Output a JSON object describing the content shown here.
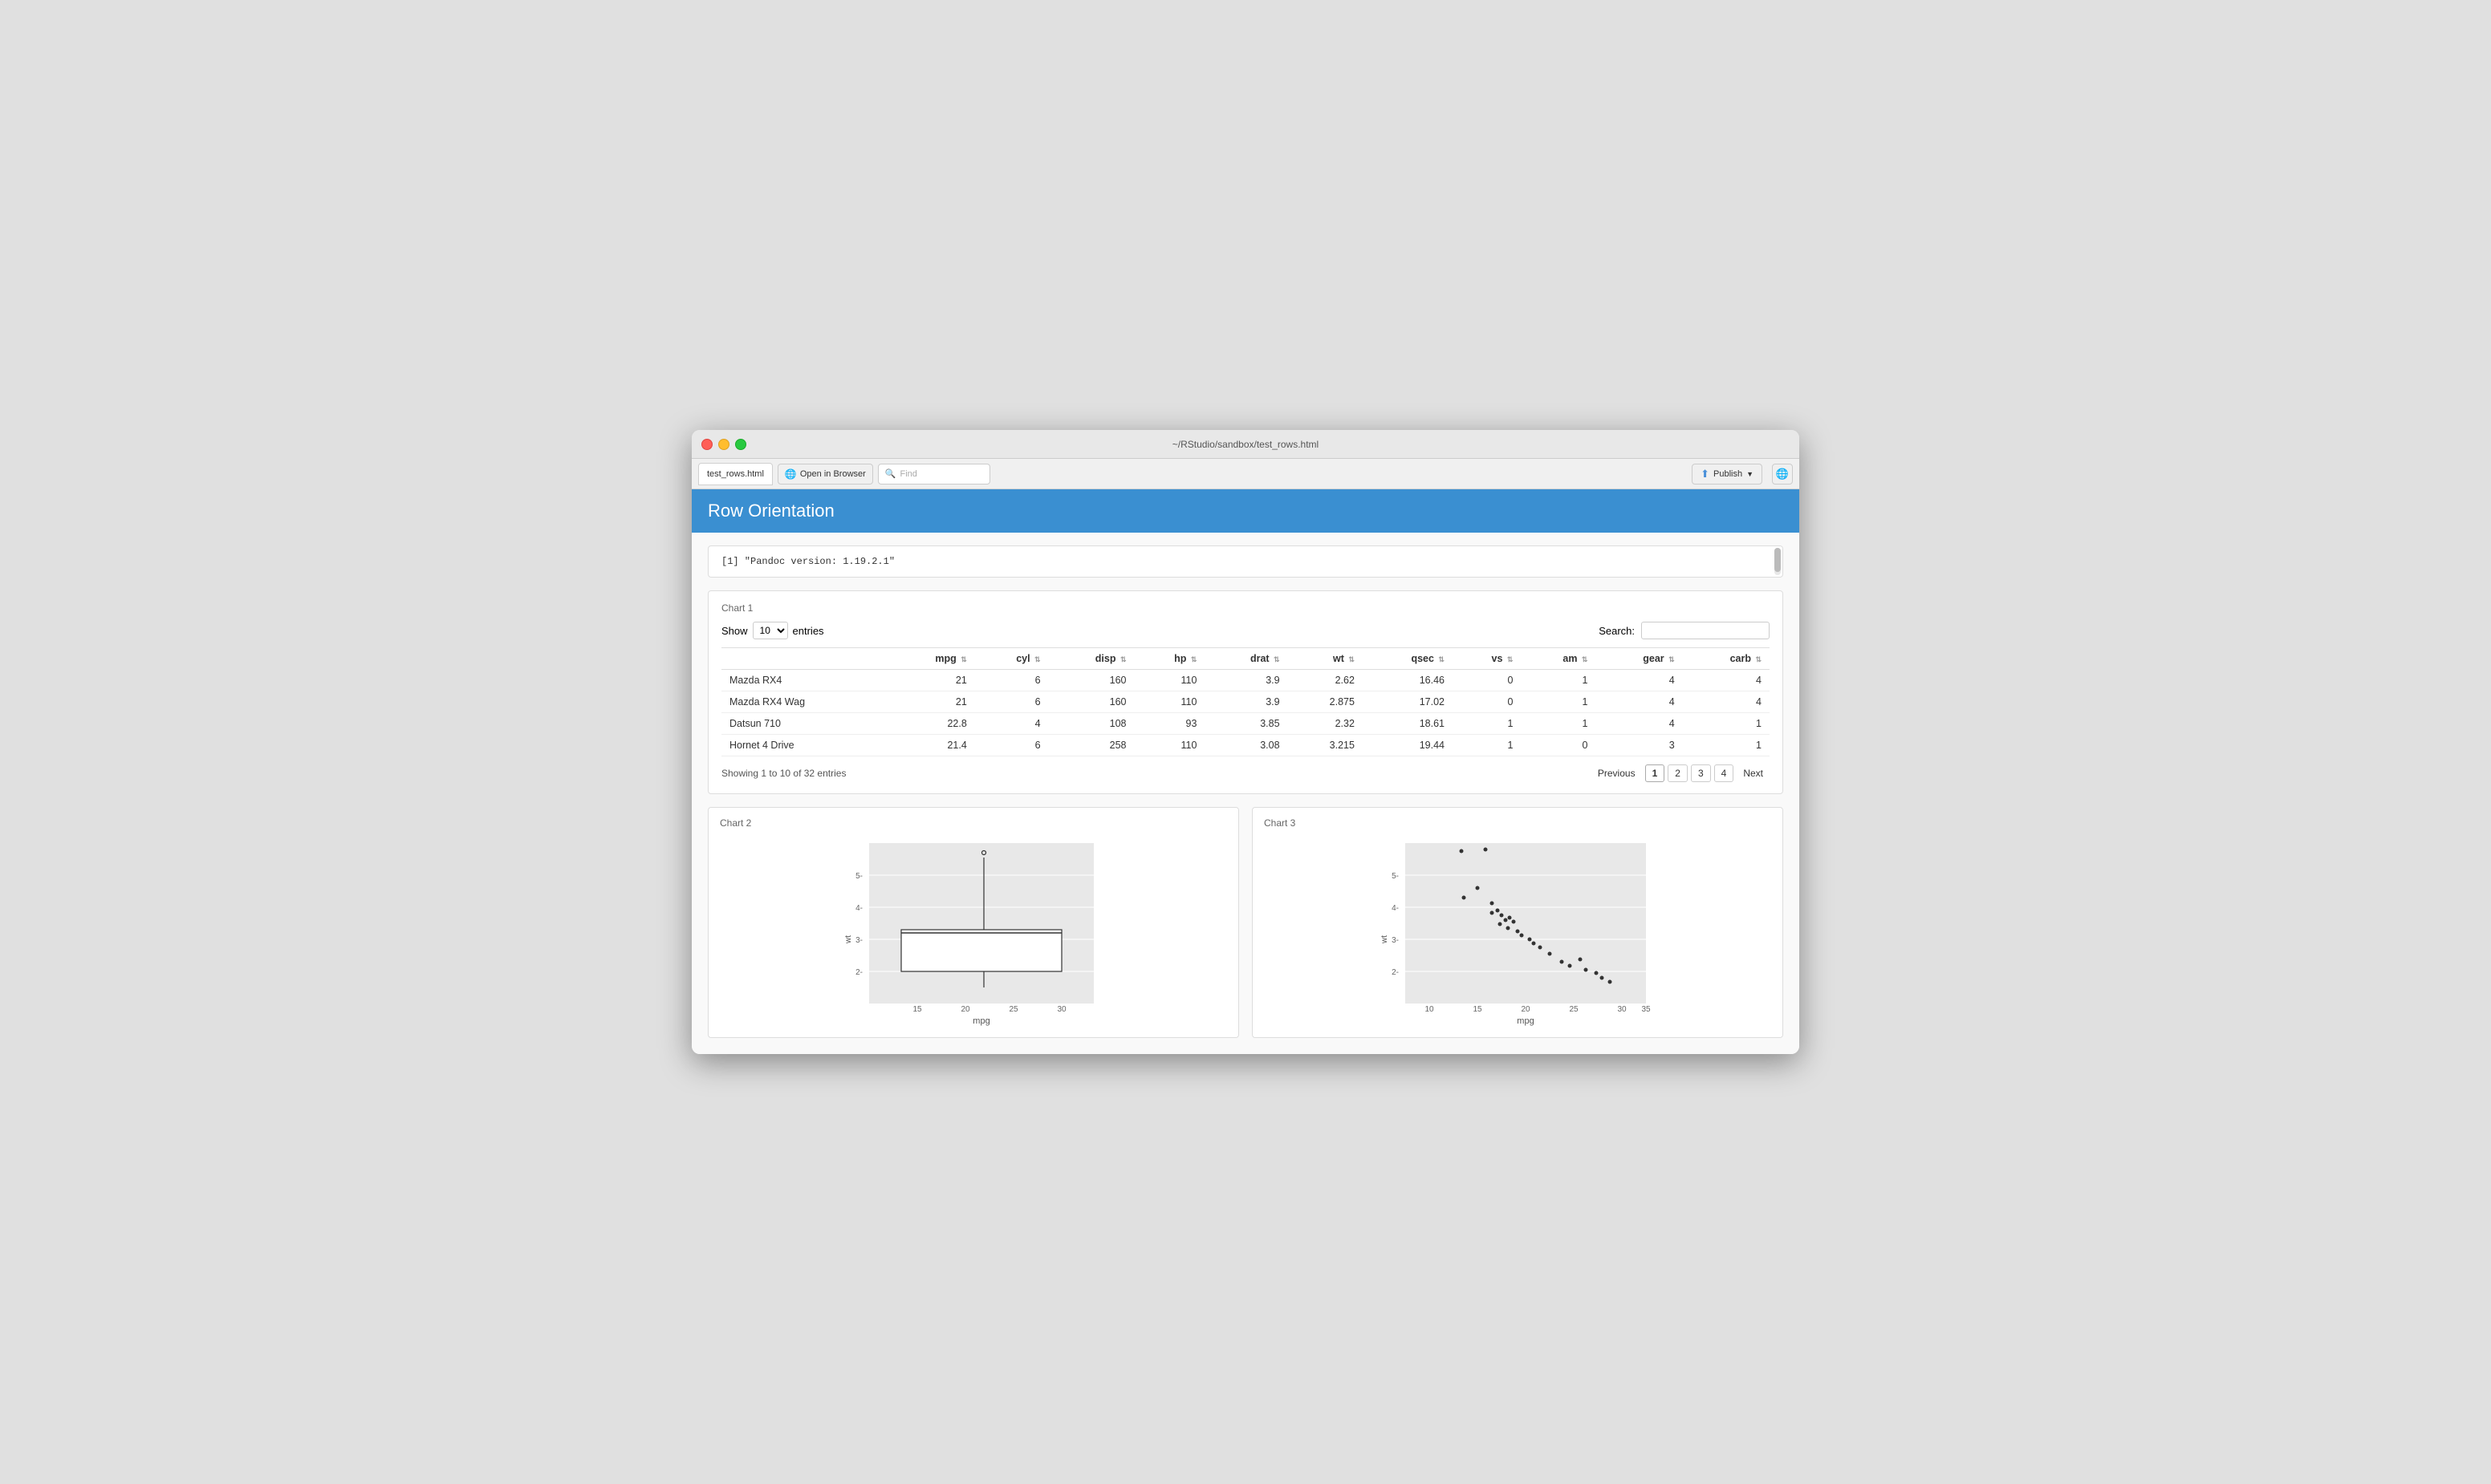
{
  "window": {
    "title": "~/RStudio/sandbox/test_rows.html"
  },
  "browser": {
    "tab_label": "test_rows.html",
    "open_in_browser": "Open in Browser",
    "find_placeholder": "Find",
    "publish_label": "Publish"
  },
  "page": {
    "header_title": "Row Orientation",
    "code_output": "[1] \"Pandoc version: 1.19.2.1\""
  },
  "chart1": {
    "label": "Chart 1",
    "show_label": "Show",
    "entries_value": "10",
    "entries_label": "entries",
    "search_label": "Search:",
    "columns": [
      "mpg",
      "cyl",
      "disp",
      "hp",
      "drat",
      "wt",
      "qsec",
      "vs",
      "am",
      "gear",
      "carb"
    ],
    "rows": [
      {
        "name": "Mazda RX4",
        "mpg": "21",
        "cyl": "6",
        "disp": "160",
        "hp": "110",
        "drat": "3.9",
        "wt": "2.62",
        "qsec": "16.46",
        "vs": "0",
        "am": "1",
        "gear": "4",
        "carb": "4"
      },
      {
        "name": "Mazda RX4 Wag",
        "mpg": "21",
        "cyl": "6",
        "disp": "160",
        "hp": "110",
        "drat": "3.9",
        "wt": "2.875",
        "qsec": "17.02",
        "vs": "0",
        "am": "1",
        "gear": "4",
        "carb": "4"
      },
      {
        "name": "Datsun 710",
        "mpg": "22.8",
        "cyl": "4",
        "disp": "108",
        "hp": "93",
        "drat": "3.85",
        "wt": "2.32",
        "qsec": "18.61",
        "vs": "1",
        "am": "1",
        "gear": "4",
        "carb": "1"
      },
      {
        "name": "Hornet 4 Drive",
        "mpg": "21.4",
        "cyl": "6",
        "disp": "258",
        "hp": "110",
        "drat": "3.08",
        "wt": "3.215",
        "qsec": "19.44",
        "vs": "1",
        "am": "0",
        "gear": "3",
        "carb": "1"
      }
    ],
    "footer_text": "Showing 1 to 10 of 32 entries",
    "pagination": {
      "previous": "Previous",
      "pages": [
        "1",
        "2",
        "3",
        "4"
      ],
      "next": "Next",
      "active_page": "1"
    }
  },
  "chart2": {
    "label": "Chart 2",
    "x_label": "mpg",
    "y_label": "wt"
  },
  "chart3": {
    "label": "Chart 3",
    "x_label": "mpg",
    "y_label": "wt"
  }
}
